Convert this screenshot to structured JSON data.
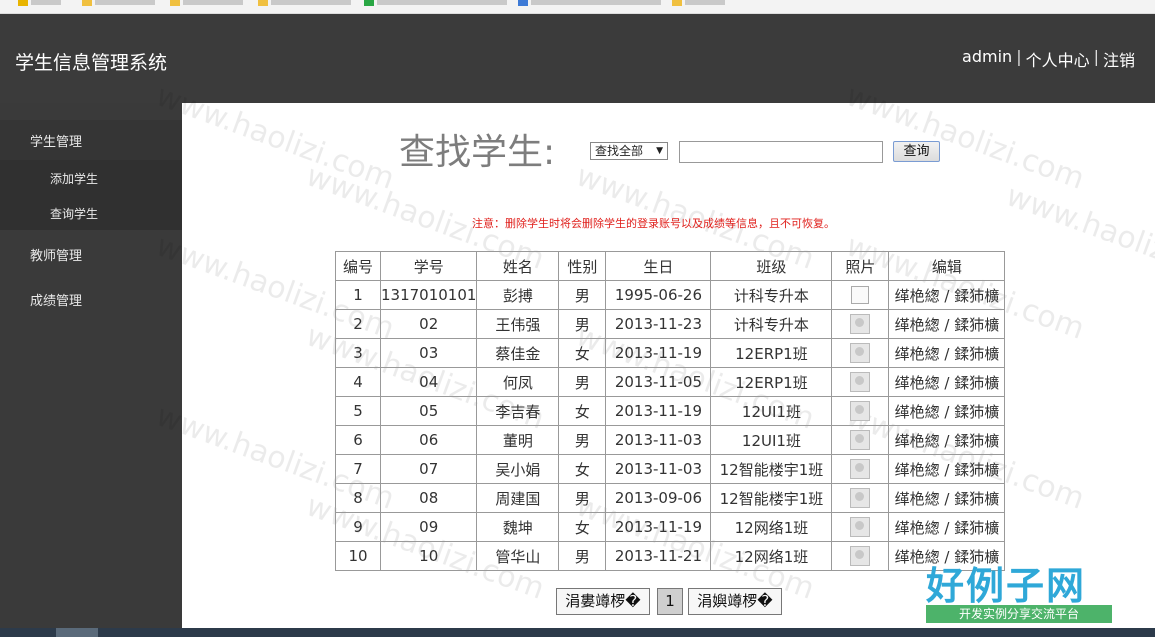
{
  "header": {
    "title": "学生信息管理系统",
    "user": "admin",
    "separator": "|",
    "profile": "个人中心",
    "logout": "注销"
  },
  "sidebar": {
    "items": [
      {
        "label": "学生管理"
      },
      {
        "label": "添加学生"
      },
      {
        "label": "查询学生"
      },
      {
        "label": "教师管理"
      },
      {
        "label": "成绩管理"
      }
    ]
  },
  "search": {
    "title": "查找学生:",
    "select_value": "查找全部",
    "input_value": "",
    "button": "查询"
  },
  "notice": "注意：删除学生时将会删除学生的登录账号以及成绩等信息，且不可恢复。",
  "table": {
    "headers": [
      "编号",
      "学号",
      "姓名",
      "性别",
      "生日",
      "班级",
      "照片",
      "编辑"
    ],
    "rows": [
      [
        "1",
        "1317010101",
        "彭搏",
        "男",
        "1995-06-26",
        "计科专升本",
        "broken",
        "缂栬緫 / 鍒犻櫎"
      ],
      [
        "2",
        "02",
        "王伟强",
        "男",
        "2013-11-23",
        "计科专升本",
        "photo",
        "缂栬緫 / 鍒犻櫎"
      ],
      [
        "3",
        "03",
        "蔡佳金",
        "女",
        "2013-11-19",
        "12ERP1班",
        "photo",
        "缂栬緫 / 鍒犻櫎"
      ],
      [
        "4",
        "04",
        "何凤",
        "男",
        "2013-11-05",
        "12ERP1班",
        "photo",
        "缂栬緫 / 鍒犻櫎"
      ],
      [
        "5",
        "05",
        "李吉春",
        "女",
        "2013-11-19",
        "12UI1班",
        "photo",
        "缂栬緫 / 鍒犻櫎"
      ],
      [
        "6",
        "06",
        "董明",
        "男",
        "2013-11-03",
        "12UI1班",
        "photo",
        "缂栬緫 / 鍒犻櫎"
      ],
      [
        "7",
        "07",
        "吴小娟",
        "女",
        "2013-11-03",
        "12智能楼宇1班",
        "photo",
        "缂栬緫 / 鍒犻櫎"
      ],
      [
        "8",
        "08",
        "周建国",
        "男",
        "2013-09-06",
        "12智能楼宇1班",
        "photo",
        "缂栬緫 / 鍒犻櫎"
      ],
      [
        "9",
        "09",
        "魏坤",
        "女",
        "2013-11-19",
        "12网络1班",
        "photo",
        "缂栬緫 / 鍒犻櫎"
      ],
      [
        "10",
        "10",
        "管华山",
        "男",
        "2013-11-21",
        "12网络1班",
        "photo",
        "缂栬緫 / 鍒犻櫎"
      ]
    ]
  },
  "pager": {
    "prev": "涓婁竴椤�",
    "page": "1",
    "next": "涓嬩竴椤�"
  },
  "branding": {
    "logo_main": "好例子网",
    "logo_sub": "开发实例分享交流平台",
    "watermark": "www.haolizi.com"
  }
}
